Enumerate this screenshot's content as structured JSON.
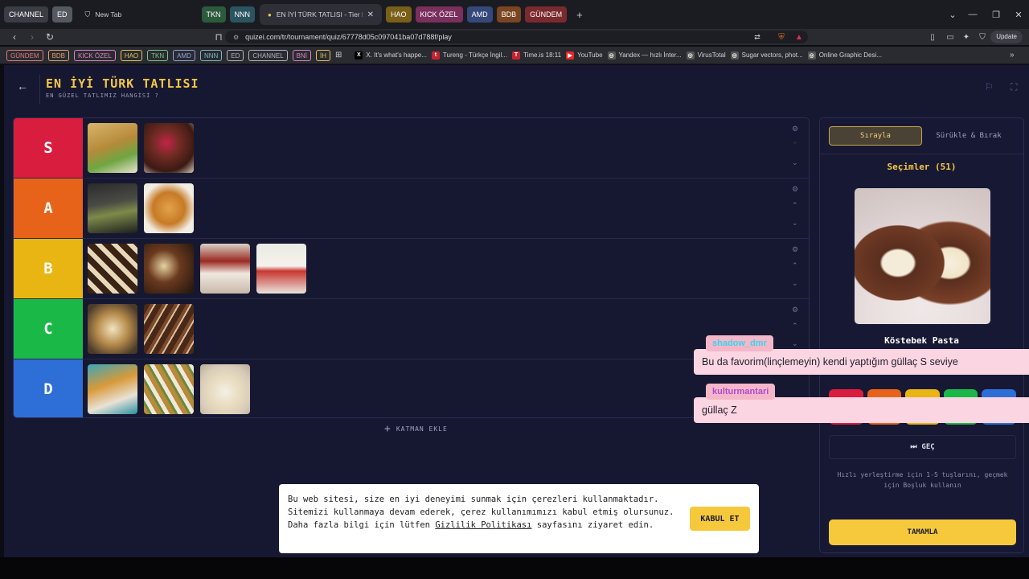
{
  "browser": {
    "tab_groups_left": [
      {
        "label": "CHANNEL",
        "color": "#3a3d44"
      },
      {
        "label": "ED",
        "color": "#555962"
      }
    ],
    "tabs": [
      {
        "label": "New Tab",
        "active": false
      },
      {
        "label": "EN İYİ TÜRK TATLISI - Tier List, Kı",
        "active": true
      }
    ],
    "tab_groups_right": [
      {
        "label": "TKN",
        "color": "#2c5a3d"
      },
      {
        "label": "NNN",
        "color": "#2a5560"
      },
      {
        "label": "HAO",
        "color": "#7a5f18"
      },
      {
        "label": "KICK ÖZEL",
        "color": "#7a2f5e"
      },
      {
        "label": "AMD",
        "color": "#34497a"
      },
      {
        "label": "BDB",
        "color": "#7a4520"
      },
      {
        "label": "GÜNDEM",
        "color": "#7a2a2e"
      }
    ],
    "url": "quizei.com/tr/tournament/quiz/67778d05c097041ba07d788f/play",
    "update_label": "Update",
    "bookmark_groups": [
      {
        "label": "GÜNDEM",
        "color": "#e07a7a"
      },
      {
        "label": "BDB",
        "color": "#e0a16a"
      },
      {
        "label": "KICK ÖZEL",
        "color": "#d884c0"
      },
      {
        "label": "HAO",
        "color": "#e0c35a"
      },
      {
        "label": "TKN",
        "color": "#7ac48e"
      },
      {
        "label": "AMD",
        "color": "#8aa2e0"
      },
      {
        "label": "NNN",
        "color": "#7ab8c4"
      },
      {
        "label": "ED",
        "color": "#b0b4bc"
      },
      {
        "label": "CHANNEL",
        "color": "#b0b4bc"
      },
      {
        "label": "BNİ",
        "color": "#d884c0"
      },
      {
        "label": "İH",
        "color": "#e0c35a"
      }
    ],
    "bookmarks": [
      {
        "label": "X. It's what's happe...",
        "icon": "x-logo-icon",
        "color": "#000000",
        "glyph": "X"
      },
      {
        "label": "Tureng - Türkçe İngil...",
        "icon": "tureng-icon",
        "color": "#c4232f",
        "glyph": "t"
      },
      {
        "label": "Time.is 18:11",
        "icon": "clock-icon",
        "color": "#c4232f",
        "glyph": "T"
      },
      {
        "label": "YouTube",
        "icon": "youtube-icon",
        "color": "#e32727",
        "glyph": "▶"
      },
      {
        "label": "Yandex — hızlı İnter...",
        "icon": "globe-icon",
        "color": "#555555",
        "glyph": "◎"
      },
      {
        "label": "VirusTotal",
        "icon": "globe-icon",
        "color": "#555555",
        "glyph": "◎"
      },
      {
        "label": "Sugar vectors, phot...",
        "icon": "globe-icon",
        "color": "#555555",
        "glyph": "◎"
      },
      {
        "label": "Online Graphic Desi...",
        "icon": "globe-icon",
        "color": "#555555",
        "glyph": "◎"
      }
    ]
  },
  "page": {
    "title": "EN İYİ TÜRK TATLISI",
    "subtitle": "EN GÜZEL TATLIMIZ HANGİSİ ?",
    "add_layer_label": "KATMAN EKLE",
    "tiers": [
      {
        "label": "S",
        "color": "#d91d3f",
        "items": 2
      },
      {
        "label": "A",
        "color": "#e8631a",
        "items": 2
      },
      {
        "label": "B",
        "color": "#e9b512",
        "items": 4
      },
      {
        "label": "C",
        "color": "#1ab847",
        "items": 2
      },
      {
        "label": "D",
        "color": "#2d6fd6",
        "items": 3
      }
    ]
  },
  "panel": {
    "mode_sequential": "Sırayla",
    "mode_drag": "Sürükle & Bırak",
    "selections_label": "Seçimler (51)",
    "current_item": "Köstebek Pasta",
    "tier_buttons": [
      {
        "label": "S",
        "color": "#d91d3f"
      },
      {
        "label": "A",
        "color": "#e8631a"
      },
      {
        "label": "B",
        "color": "#e9b512"
      },
      {
        "label": "C",
        "color": "#1ab847"
      },
      {
        "label": "D",
        "color": "#2d6fd6"
      }
    ],
    "skip_label": "GEÇ",
    "hint": "Hızlı yerleştirme için 1-5 tuşlarını, geçmek için Boşluk kullanın",
    "finish_label": "TAMAMLA"
  },
  "chat": [
    {
      "user": "shadow_dmr",
      "user_color": "#35d6f0",
      "message": "Bu da favorim(linçlemeyin) kendi yaptığım güllaç S seviye"
    },
    {
      "user": "kulturmantari",
      "user_color": "#b04ad0",
      "message": "güllaç Z"
    }
  ],
  "cookie": {
    "text_before": "Bu web sitesi, size en iyi deneyimi sunmak için çerezleri kullanmaktadır. Sitemizi kullanmaya devam ederek, çerez kullanımımızı kabul etmiş olursunuz. Daha fazla bilgi için lütfen ",
    "link": "Gizlilik Politikası",
    "text_after": " sayfasını ziyaret edin.",
    "accept_label": "KABUL ET"
  }
}
